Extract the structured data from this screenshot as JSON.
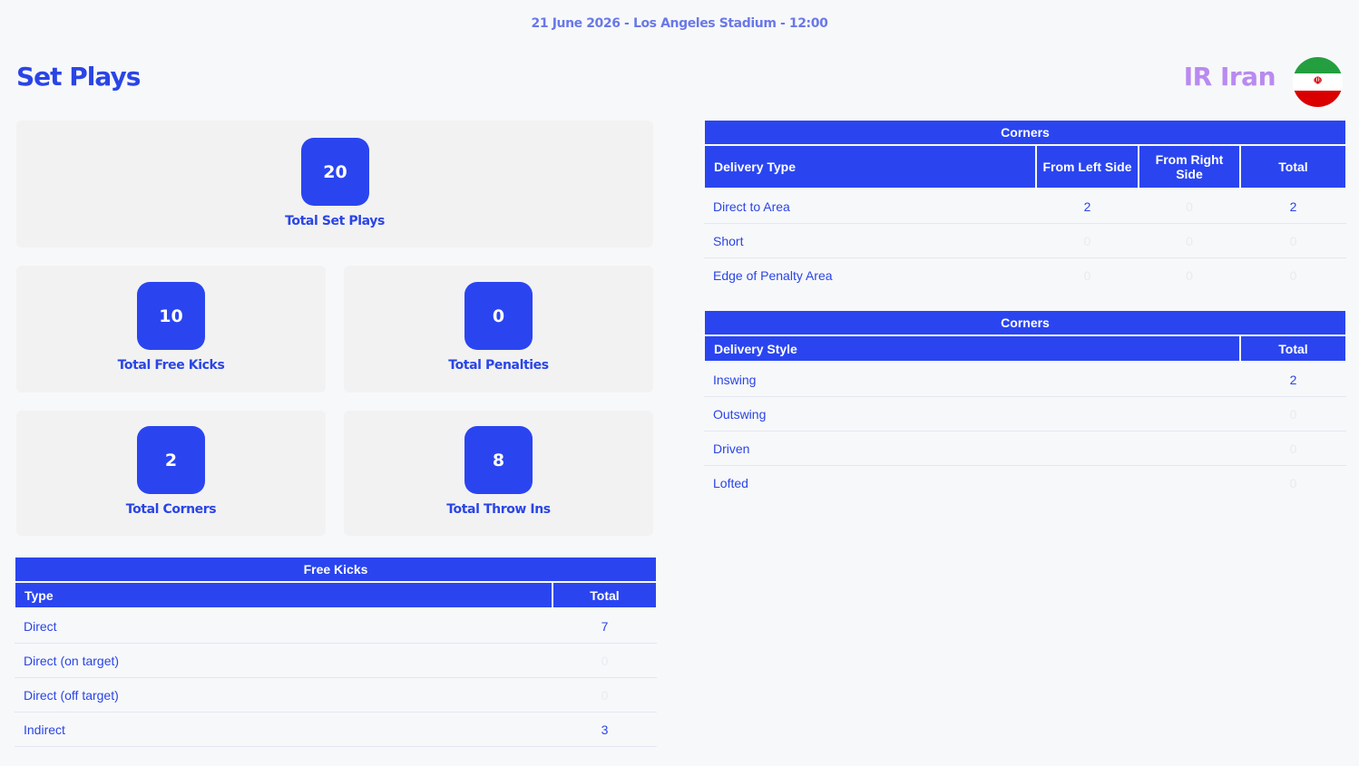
{
  "match_info": "21 June 2026 - Los Angeles Stadium - 12:00",
  "page_title": "Set Plays",
  "team_name": "IR Iran",
  "colors": {
    "accent": "#2a45f0",
    "team_name": "#b98af0"
  },
  "flag_icon": "iran-flag-icon",
  "stats": {
    "total_set_plays": {
      "value": "20",
      "label": "Total Set Plays"
    },
    "total_free_kicks": {
      "value": "10",
      "label": "Total Free Kicks"
    },
    "total_penalties": {
      "value": "0",
      "label": "Total Penalties"
    },
    "total_corners": {
      "value": "2",
      "label": "Total Corners"
    },
    "total_throw_ins": {
      "value": "8",
      "label": "Total Throw Ins"
    }
  },
  "free_kicks": {
    "caption": "Free Kicks",
    "headers": [
      "Type",
      "Total"
    ],
    "rows": [
      {
        "label": "Direct",
        "total": "7"
      },
      {
        "label": "Direct (on target)",
        "total": "0"
      },
      {
        "label": "Direct (off target)",
        "total": "0"
      },
      {
        "label": "Indirect",
        "total": "3"
      }
    ]
  },
  "corners_delivery_type": {
    "caption": "Corners",
    "headers": [
      "Delivery Type",
      "From Left Side",
      "From Right Side",
      "Total"
    ],
    "rows": [
      {
        "label": "Direct to Area",
        "left": "2",
        "right": "0",
        "total": "2"
      },
      {
        "label": "Short",
        "left": "0",
        "right": "0",
        "total": "0"
      },
      {
        "label": "Edge of Penalty Area",
        "left": "0",
        "right": "0",
        "total": "0"
      }
    ]
  },
  "corners_delivery_style": {
    "caption": "Corners",
    "headers": [
      "Delivery Style",
      "Total"
    ],
    "rows": [
      {
        "label": "Inswing",
        "total": "2"
      },
      {
        "label": "Outswing",
        "total": "0"
      },
      {
        "label": "Driven",
        "total": "0"
      },
      {
        "label": "Lofted",
        "total": "0"
      }
    ]
  }
}
